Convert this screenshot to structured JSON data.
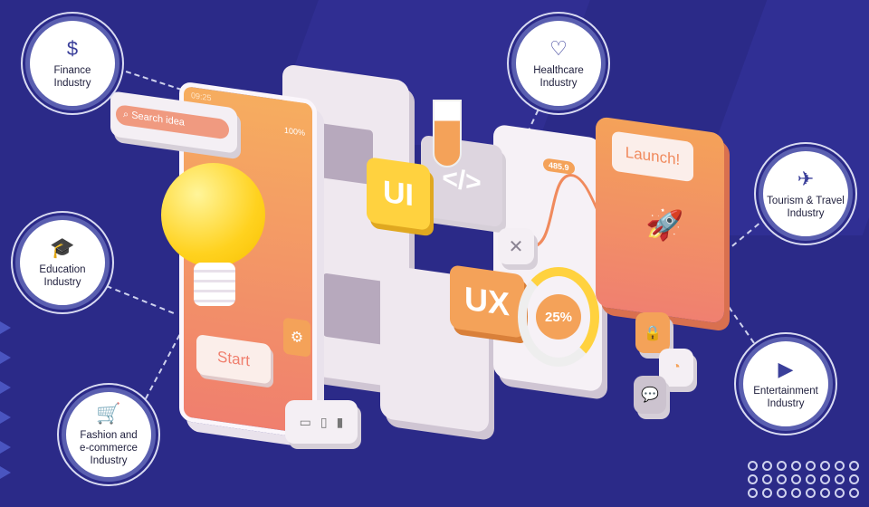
{
  "industries": [
    {
      "label": "Finance\nIndustry",
      "icon": "coins-dollar-icon",
      "glyph": "$"
    },
    {
      "label": "Healthcare\nIndustry",
      "icon": "hands-heart-icon",
      "glyph": "♡"
    },
    {
      "label": "Tourism & Travel\nIndustry",
      "icon": "traveler-icon",
      "glyph": "✈"
    },
    {
      "label": "Education\nIndustry",
      "icon": "classroom-icon",
      "glyph": "🎓"
    },
    {
      "label": "Entertainment\nIndustry",
      "icon": "media-screen-icon",
      "glyph": "▶"
    },
    {
      "label": "Fashion and\ne-commerce\nIndustry",
      "icon": "shopping-cart-icon",
      "glyph": "🛒"
    }
  ],
  "phone": {
    "time": "09:25",
    "battery": "100%",
    "start_label": "Start"
  },
  "search": {
    "placeholder": "Search idea"
  },
  "tiles": {
    "ui": "UI",
    "ux": "UX",
    "code": "</>",
    "percent": "25%",
    "chart_value": "485.9",
    "launch": "Launch!"
  },
  "colors": {
    "background": "#2b2a88",
    "orange": "#f4a259",
    "yellow": "#ffd23f",
    "accent_ring": "#5a5fb0"
  }
}
